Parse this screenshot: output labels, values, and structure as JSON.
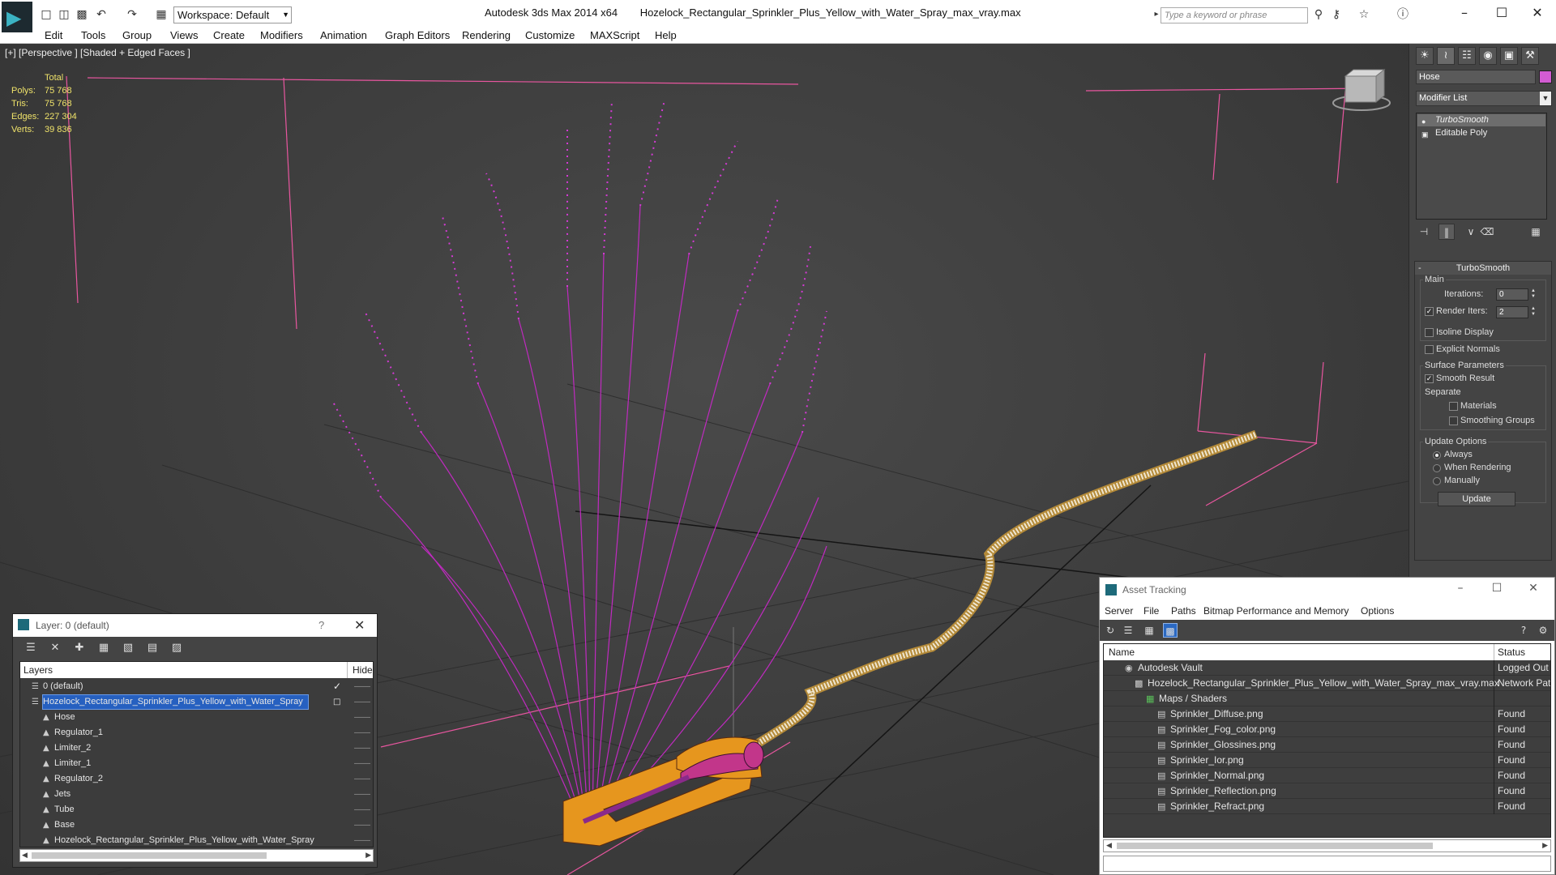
{
  "titlebar": {
    "app_name": "Autodesk 3ds Max  2014 x64",
    "file_name": "Hozelock_Rectangular_Sprinkler_Plus_Yellow_with_Water_Spray_max_vray.max",
    "workspace": "Workspace: Default",
    "search_placeholder": "Type a keyword or phrase"
  },
  "menu": [
    "Edit",
    "Tools",
    "Group",
    "Views",
    "Create",
    "Modifiers",
    "Animation",
    "Graph Editors",
    "Rendering",
    "Customize",
    "MAXScript",
    "Help"
  ],
  "viewport": {
    "label": "[+] [Perspective ] [Shaded + Edged Faces ]",
    "stats": {
      "header": "Total",
      "rows": [
        {
          "label": "Polys:",
          "value": "75 768"
        },
        {
          "label": "Tris:",
          "value": "75 768"
        },
        {
          "label": "Edges:",
          "value": "227 304"
        },
        {
          "label": "Verts:",
          "value": "39 836"
        }
      ]
    }
  },
  "command_panel": {
    "object_name": "Hose",
    "object_color": "#d25cd2",
    "modifier_list": "Modifier List",
    "stack": [
      "TurboSmooth",
      "Editable Poly"
    ],
    "rollout_title": "TurboSmooth",
    "main_label": "Main",
    "iterations_label": "Iterations:",
    "iterations_value": "0",
    "render_iters_label": "Render Iters:",
    "render_iters_value": "2",
    "isoline_label": "Isoline Display",
    "explicit_normals_label": "Explicit Normals",
    "surface_label": "Surface Parameters",
    "smooth_result_label": "Smooth Result",
    "separate_label": "Separate",
    "materials_label": "Materials",
    "smoothing_groups_label": "Smoothing Groups",
    "update_options_label": "Update Options",
    "always_label": "Always",
    "when_rendering_label": "When Rendering",
    "manually_label": "Manually",
    "update_button": "Update"
  },
  "layer_panel": {
    "title": "Layer: 0 (default)",
    "help": "?",
    "col_layers": "Layers",
    "col_hide": "Hide",
    "rows": [
      {
        "name": "0 (default)",
        "level": 1
      },
      {
        "name": "Hozelock_Rectangular_Sprinkler_Plus_Yellow_with_Water_Spray",
        "level": 1
      },
      {
        "name": "Hose",
        "level": 2
      },
      {
        "name": "Regulator_1",
        "level": 2
      },
      {
        "name": "Limiter_2",
        "level": 2
      },
      {
        "name": "Limiter_1",
        "level": 2
      },
      {
        "name": "Regulator_2",
        "level": 2
      },
      {
        "name": "Jets",
        "level": 2
      },
      {
        "name": "Tube",
        "level": 2
      },
      {
        "name": "Base",
        "level": 2
      },
      {
        "name": "Hozelock_Rectangular_Sprinkler_Plus_Yellow_with_Water_Spray",
        "level": 2
      }
    ]
  },
  "asset_tracking": {
    "title": "Asset Tracking",
    "menu": [
      "Server",
      "File",
      "Paths",
      "Bitmap Performance and Memory",
      "Options"
    ],
    "col_name": "Name",
    "col_status": "Status",
    "rows": [
      {
        "name": "Autodesk Vault",
        "status": "Logged Out ..."
      },
      {
        "name": "Hozelock_Rectangular_Sprinkler_Plus_Yellow_with_Water_Spray_max_vray.max",
        "status": "Network Path"
      },
      {
        "name": "Maps / Shaders",
        "status": ""
      },
      {
        "name": "Sprinkler_Diffuse.png",
        "status": "Found"
      },
      {
        "name": "Sprinkler_Fog_color.png",
        "status": "Found"
      },
      {
        "name": "Sprinkler_Glossines.png",
        "status": "Found"
      },
      {
        "name": "Sprinkler_Ior.png",
        "status": "Found"
      },
      {
        "name": "Sprinkler_Normal.png",
        "status": "Found"
      },
      {
        "name": "Sprinkler_Reflection.png",
        "status": "Found"
      },
      {
        "name": "Sprinkler_Refract.png",
        "status": "Found"
      }
    ]
  }
}
